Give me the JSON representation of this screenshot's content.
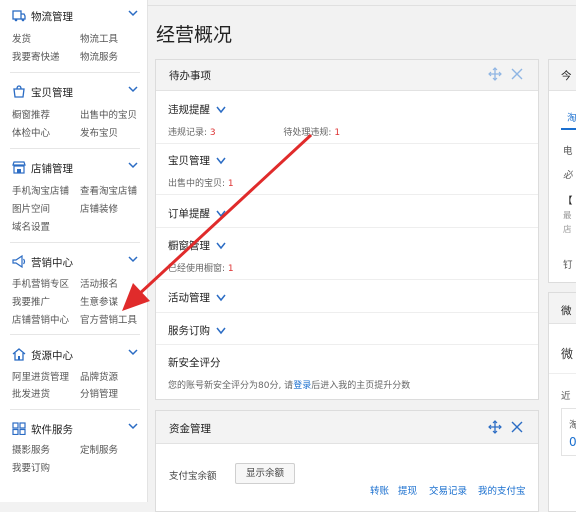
{
  "sidebar": {
    "sections": [
      {
        "title": "物流管理",
        "icon": "logistics-icon",
        "links": [
          "发货",
          "物流工具",
          "我要寄快递",
          "物流服务"
        ]
      },
      {
        "title": "宝贝管理",
        "icon": "goods-icon",
        "links": [
          "橱窗推荐",
          "出售中的宝贝",
          "体检中心",
          "发布宝贝"
        ]
      },
      {
        "title": "店铺管理",
        "icon": "store-icon",
        "links": [
          "手机淘宝店铺",
          "查看淘宝店铺",
          "图片空间",
          "店铺装修",
          "域名设置"
        ]
      },
      {
        "title": "营销中心",
        "icon": "megaphone-icon",
        "links": [
          "手机营销专区",
          "活动报名",
          "我要推广",
          "生意参谋",
          "店铺营销中心",
          "官方营销工具"
        ]
      },
      {
        "title": "货源中心",
        "icon": "house-icon",
        "links": [
          "阿里进货管理",
          "品牌货源",
          "批发进货",
          "分销管理"
        ]
      },
      {
        "title": "软件服务",
        "icon": "apps-icon",
        "links": [
          "摄影服务",
          "定制服务",
          "我要订购"
        ]
      }
    ]
  },
  "main": {
    "page_title": "经营概况",
    "todo_panel": {
      "title": "待办事项",
      "items": [
        {
          "title": "违规提醒",
          "line_parts": [
            "违规记录:",
            "3",
            "待处理违规:",
            "1"
          ]
        },
        {
          "title": "宝贝管理",
          "line_parts": [
            "出售中的宝贝:",
            "1"
          ]
        },
        {
          "title": "订单提醒"
        },
        {
          "title": "橱窗管理",
          "line_parts": [
            "已经使用橱窗:",
            "1"
          ]
        },
        {
          "title": "活动管理"
        },
        {
          "title": "服务订购"
        },
        {
          "title": "新安全评分",
          "line_parts": [
            "您的账号新安全评分为80分, 请",
            "登录",
            "后进入我的主页提升分数"
          ]
        }
      ]
    },
    "fund_panel": {
      "title": "资金管理",
      "balance_label": "支付宝余额",
      "show_balance_button": "显示余额",
      "links": [
        "转账",
        "提现",
        "交易记录",
        "我的支付宝"
      ]
    },
    "right_top_panel": {
      "title_fragment": "今",
      "tab_fragment": "淘",
      "texts": [
        "电",
        "必",
        "【",
        "最",
        "店",
        "钉"
      ]
    },
    "right_bottom_panel": {
      "title_fragment": "微",
      "texts": [
        "微",
        "近",
        "淘",
        "0"
      ]
    }
  },
  "colors": {
    "accent": "#1a6fcf",
    "red_num": "#d33333",
    "arrow": "#e02b2b"
  }
}
